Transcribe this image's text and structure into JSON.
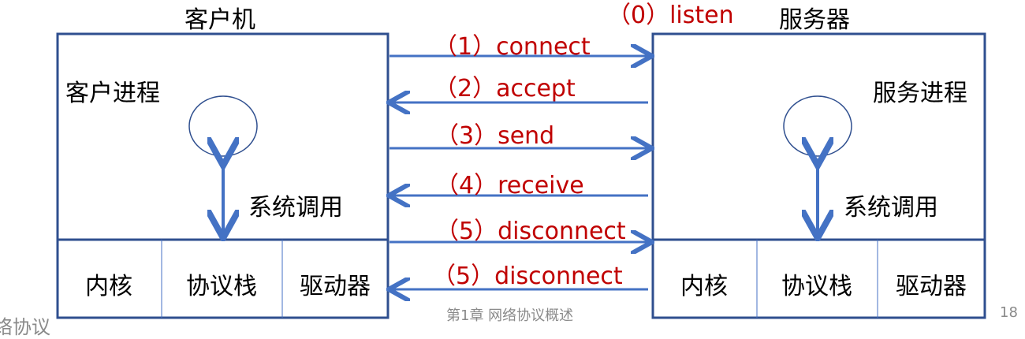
{
  "client": {
    "title": "客户机",
    "process": "客户进程",
    "syscall": "系统调用",
    "cells": [
      "内核",
      "协议栈",
      "驱动器"
    ]
  },
  "server": {
    "title": "服务器",
    "process": "服务进程",
    "syscall": "系统调用",
    "cells": [
      "内核",
      "协议栈",
      "驱动器"
    ]
  },
  "steps": {
    "listen": "（0）listen",
    "connect": "（1）connect",
    "accept": "（2）accept",
    "send": "（3）send",
    "receive": "（4）receive",
    "disconnect1": "（5）disconnect",
    "disconnect2": "（5）disconnect"
  },
  "footer": {
    "left": "络协议",
    "center": "第1章 网络协议概述",
    "page": "18"
  },
  "colors": {
    "box": "#2f4f8f",
    "arrow": "#4472c4",
    "label": "#c00000"
  }
}
